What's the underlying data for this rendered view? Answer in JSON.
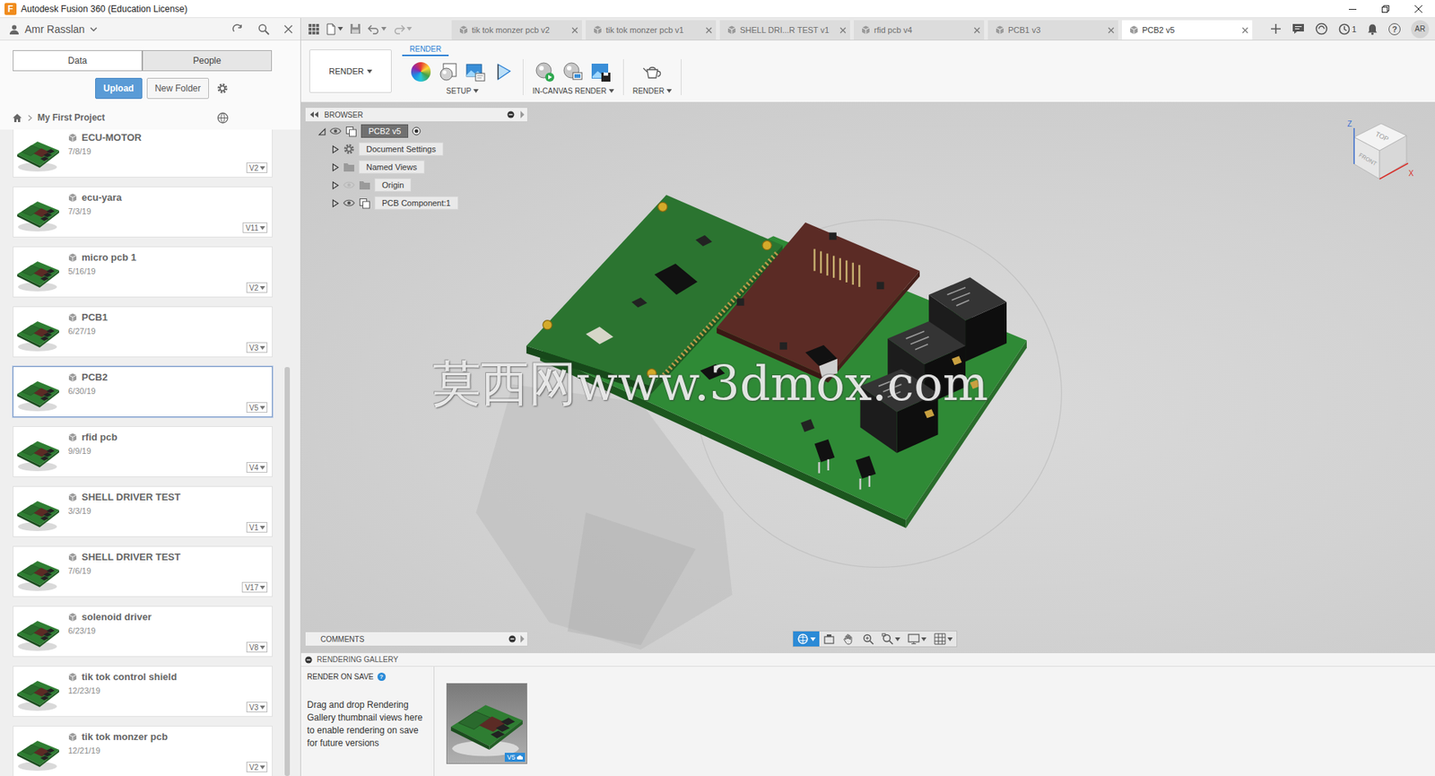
{
  "window": {
    "title": "Autodesk Fusion 360 (Education License)",
    "app_icon": "F"
  },
  "data_panel": {
    "user": "Amr Rasslan",
    "tabs": [
      {
        "label": "Data",
        "selected": true
      },
      {
        "label": "People",
        "selected": false
      }
    ],
    "buttons": [
      {
        "label": "Upload",
        "kind": "primary"
      },
      {
        "label": "New Folder",
        "kind": "secondary"
      }
    ],
    "breadcrumb": "My First Project",
    "items": [
      {
        "name": "ECU-MOTOR",
        "date": "7/8/19",
        "version": "V2",
        "selected": false
      },
      {
        "name": "ecu-yara",
        "date": "7/3/19",
        "version": "V11",
        "selected": false
      },
      {
        "name": "micro pcb 1",
        "date": "5/16/19",
        "version": "V2",
        "selected": false
      },
      {
        "name": "PCB1",
        "date": "6/27/19",
        "version": "V3",
        "selected": false
      },
      {
        "name": "PCB2",
        "date": "6/30/19",
        "version": "V5",
        "selected": true
      },
      {
        "name": "rfid pcb",
        "date": "9/9/19",
        "version": "V4",
        "selected": false
      },
      {
        "name": "SHELL DRIVER TEST",
        "date": "3/3/19",
        "version": "V1",
        "selected": false
      },
      {
        "name": "SHELL DRIVER TEST",
        "date": "7/6/19",
        "version": "V17",
        "selected": false
      },
      {
        "name": "solenoid driver",
        "date": "6/23/19",
        "version": "V8",
        "selected": false
      },
      {
        "name": "tik tok control shield",
        "date": "12/23/19",
        "version": "V3",
        "selected": false
      },
      {
        "name": "tik tok monzer pcb",
        "date": "12/21/19",
        "version": "V2",
        "selected": false
      }
    ]
  },
  "document_tabs": [
    {
      "label": "tik tok monzer pcb v2",
      "selected": false
    },
    {
      "label": "tik tok monzer pcb v1",
      "selected": false
    },
    {
      "label": "SHELL DRI...R TEST v1",
      "selected": false
    },
    {
      "label": "rfid pcb v4",
      "selected": false
    },
    {
      "label": "PCB1 v3",
      "selected": false
    },
    {
      "label": "PCB2 v5",
      "selected": true
    }
  ],
  "header": {
    "job_count": "1",
    "help": "?",
    "avatar": "AR"
  },
  "toolbar": {
    "workspace": "RENDER",
    "tab": "RENDER",
    "groups": [
      {
        "label": "SETUP",
        "kind": "setup"
      },
      {
        "label": "IN-CANVAS RENDER",
        "kind": "in-canvas"
      },
      {
        "label": "RENDER",
        "kind": "render"
      }
    ]
  },
  "browser": {
    "title": "BROWSER",
    "root": {
      "label": "PCB2 v5",
      "expanded": true,
      "visible": true
    },
    "nodes": [
      {
        "label": "Document Settings",
        "kind": "settings",
        "expanded": false
      },
      {
        "label": "Named Views",
        "kind": "folder",
        "expanded": false
      },
      {
        "label": "Origin",
        "kind": "folder",
        "expanded": false,
        "visible": false
      },
      {
        "label": "PCB Component:1",
        "kind": "component",
        "expanded": false,
        "visible": true
      }
    ]
  },
  "comments": {
    "title": "COMMENTS"
  },
  "viewcube": {
    "faces": [
      "TOP",
      "FRONT"
    ],
    "axes": [
      {
        "label": "Z",
        "color": "#3b6fd1"
      },
      {
        "label": "X",
        "color": "#d9302b"
      }
    ]
  },
  "watermark": "莫西网www.3dmox.com",
  "navigation": [
    {
      "kind": "orbit",
      "selected": true
    },
    {
      "kind": "look-at",
      "selected": false
    },
    {
      "kind": "pan",
      "selected": false
    },
    {
      "kind": "zoom",
      "selected": false
    },
    {
      "kind": "zoom-window",
      "selected": false
    },
    {
      "kind": "display",
      "selected": false
    },
    {
      "kind": "grid",
      "selected": false
    }
  ],
  "gallery": {
    "title": "RENDERING GALLERY",
    "render_on_save": "RENDER ON SAVE",
    "help": "?",
    "hint": "Drag and drop Rendering Gallery thumbnail views here to enable rendering on save for future versions",
    "thumbnails": [
      {
        "badge": "V5"
      }
    ]
  }
}
